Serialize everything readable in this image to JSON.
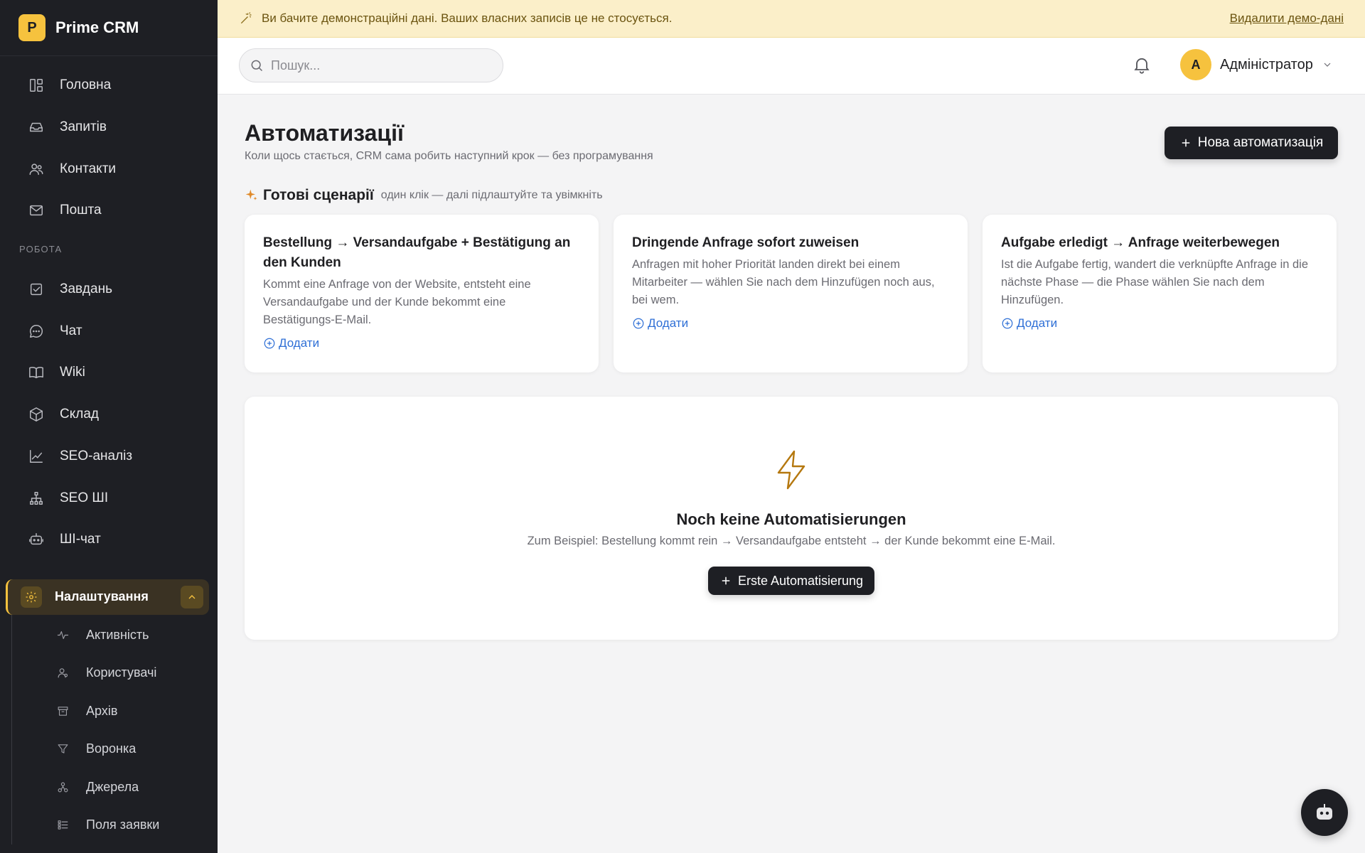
{
  "brand": {
    "logo_letter": "P",
    "name": "Prime CRM",
    "accent": "#f6c23e"
  },
  "sidebar": {
    "primary": [
      {
        "label": "Головна",
        "icon": "dashboard-icon"
      },
      {
        "label": "Запитів",
        "icon": "inbox-icon"
      },
      {
        "label": "Контакти",
        "icon": "users-icon"
      },
      {
        "label": "Пошта",
        "icon": "mail-icon"
      }
    ],
    "section_label": "РОБОТА",
    "work": [
      {
        "label": "Завдань",
        "icon": "checkbox-icon"
      },
      {
        "label": "Чат",
        "icon": "chat-icon"
      },
      {
        "label": "Wiki",
        "icon": "book-icon"
      },
      {
        "label": "Склад",
        "icon": "box-icon"
      },
      {
        "label": "SEO-аналіз",
        "icon": "chart-line-icon"
      },
      {
        "label": "SEO ШІ",
        "icon": "network-icon"
      },
      {
        "label": "ШІ-чат",
        "icon": "robot-icon"
      }
    ],
    "active": {
      "label": "Налаштування",
      "icon": "gear-icon"
    },
    "sub": [
      {
        "label": "Активність",
        "icon": "activity-icon"
      },
      {
        "label": "Користувачі",
        "icon": "user-icon"
      },
      {
        "label": "Архів",
        "icon": "archive-icon"
      },
      {
        "label": "Воронка",
        "icon": "funnel-icon"
      },
      {
        "label": "Джерела",
        "icon": "sources-icon"
      },
      {
        "label": "Поля заявки",
        "icon": "fields-icon"
      }
    ]
  },
  "banner": {
    "text": "Ви бачите демонстраційні дані. Ваших власних записів це не стосується.",
    "link": "Видалити демо-дані"
  },
  "header": {
    "search_placeholder": "Пошук...",
    "user": {
      "initial": "A",
      "name": "Адміністратор"
    }
  },
  "main": {
    "title": "Автоматизації",
    "subtitle": "Коли щось стається, CRM сама робить наступний крок — без програмування",
    "new_button": "Нова автоматизація",
    "ready": {
      "title": "Готові сценарії",
      "hint": "один клік — далі підлаштуйте та увімкніть",
      "cards": [
        {
          "title": "Bestellung → Versandaufgabe + Bestätigung an den Kunden",
          "desc": "Kommt eine Anfrage von der Website, entsteht eine Versandaufgabe und der Kunde bekommt eine Bestätigungs-E-Mail.",
          "add": "Додати"
        },
        {
          "title": "Dringende Anfrage sofort zuweisen",
          "desc": "Anfragen mit hoher Priorität landen direkt bei einem Mitarbeiter — wählen Sie nach dem Hinzufügen noch aus, bei wem.",
          "add": "Додати"
        },
        {
          "title": "Aufgabe erledigt → Anfrage weiterbewegen",
          "desc": "Ist die Aufgabe fertig, wandert die verknüpfte Anfrage in die nächste Phase — die Phase wählen Sie nach dem Hinzufügen.",
          "add": "Додати"
        }
      ]
    },
    "empty": {
      "title": "Noch keine Automatisierungen",
      "desc": "Zum Beispiel: Bestellung kommt rein → Versandaufgabe entsteht → der Kunde bekommt eine E-Mail.",
      "button": "Erste Automatisierung"
    }
  }
}
